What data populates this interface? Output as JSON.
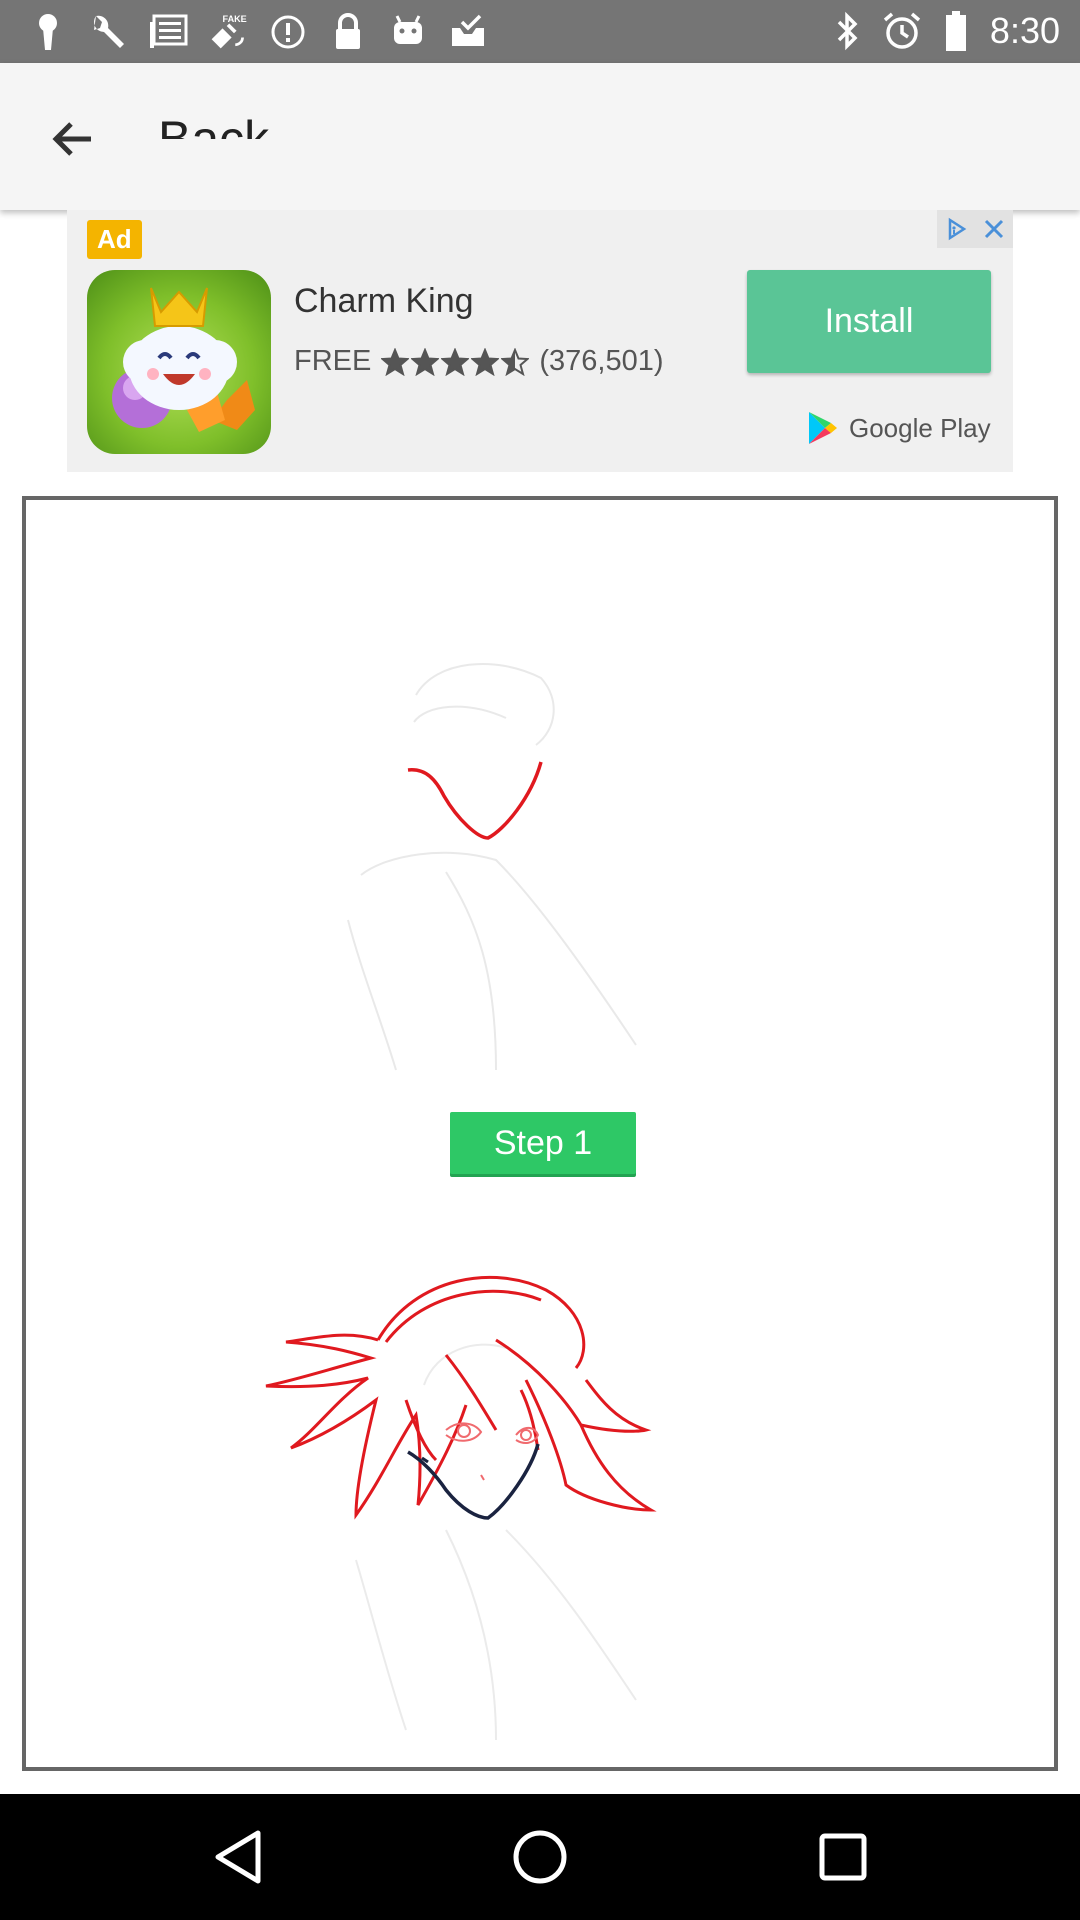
{
  "status_bar": {
    "time": "8:30",
    "left_icons": [
      "keyhole-icon",
      "wrench-icon",
      "news-icon",
      "fake-gps-icon",
      "info-icon",
      "lock-icon",
      "android-icon",
      "inbox-icon"
    ],
    "right_icons": [
      "bluetooth-icon",
      "alarm-icon",
      "battery-icon"
    ]
  },
  "app_bar": {
    "title": "Back"
  },
  "ad": {
    "badge": "Ad",
    "app_name": "Charm King",
    "price": "FREE",
    "rating": 4.5,
    "reviews": "(376,501)",
    "install_label": "Install",
    "store": "Google Play",
    "colors": {
      "install": "#5ac596",
      "badge": "#f4b400"
    }
  },
  "drawing": {
    "step_label": "Step 1",
    "step_color": "#2ec866",
    "stroke_color": "#e0191f"
  },
  "nav_bar": {
    "buttons": [
      "back-icon",
      "home-icon",
      "recents-icon"
    ]
  }
}
